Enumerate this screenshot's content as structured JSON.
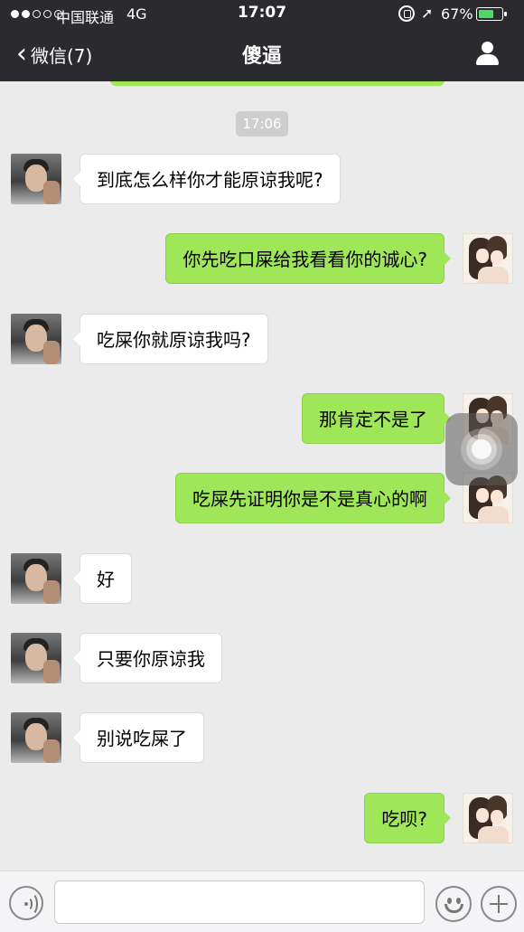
{
  "status_bar": {
    "signal_dots": [
      "on",
      "on",
      "off",
      "off",
      "off"
    ],
    "carrier": "中国联通",
    "network": "4G",
    "time": "17:07",
    "battery_percent": "67%",
    "battery_level": 0.67,
    "icons": [
      "signal-dots-icon",
      "orientation-lock-icon",
      "location-arrow-icon",
      "battery-icon"
    ]
  },
  "nav": {
    "back_label": "微信(7)",
    "title": "傻逼",
    "icons": {
      "back": "chevron-left-icon",
      "contact": "person-icon"
    }
  },
  "chat": {
    "timestamp": "17:06",
    "messages": [
      {
        "side": "left",
        "text": "到底怎么样你才能原谅我呢?"
      },
      {
        "side": "right",
        "text": "你先吃口屎给我看看你的诚心?"
      },
      {
        "side": "left",
        "text": "吃屎你就原谅我吗?"
      },
      {
        "side": "right",
        "text": "那肯定不是了"
      },
      {
        "side": "right",
        "text": "吃屎先证明你是不是真心的啊"
      },
      {
        "side": "left",
        "text": "好"
      },
      {
        "side": "left",
        "text": "只要你原谅我"
      },
      {
        "side": "left",
        "text": "别说吃屎了"
      },
      {
        "side": "right",
        "text": "吃呗?"
      }
    ]
  },
  "input_bar": {
    "value": "",
    "icons": {
      "voice": "voice-icon",
      "emoji": "emoji-icon",
      "add": "plus-icon"
    }
  },
  "colors": {
    "header_bg": "#2b2b2f",
    "chat_bg": "#ebebeb",
    "sent_bubble": "#9fe658",
    "received_bubble": "#ffffff",
    "battery_fill": "#4cd964"
  }
}
